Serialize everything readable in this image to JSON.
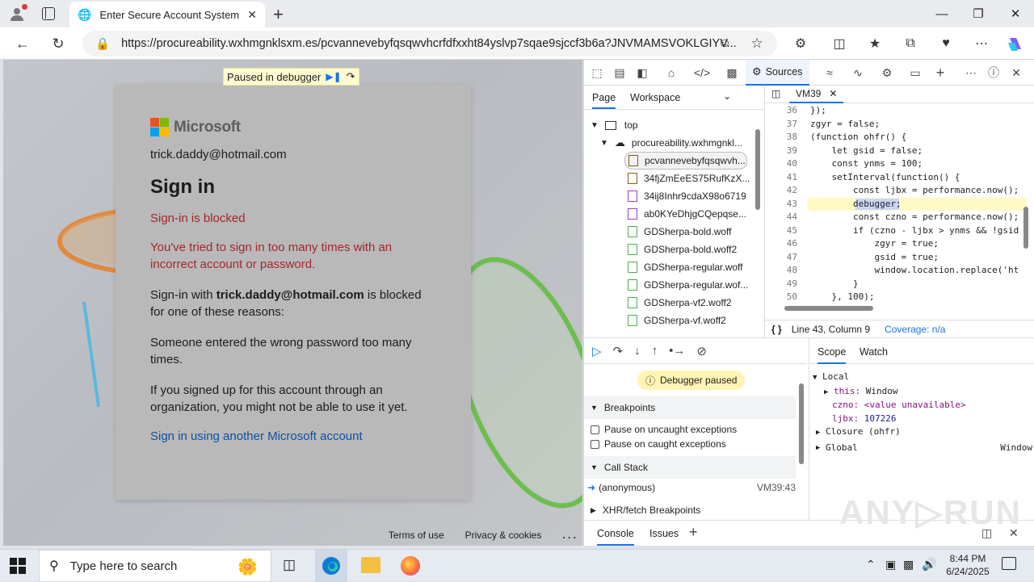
{
  "browser": {
    "tab_title": "Enter Secure Account System",
    "url": "https://procureability.wxhmgnklsxm.es/pcvannevebyfqsqwvhcrfdfxxht84yslvp7sqae9sjccf3b6a?JNVMAMSVOKLGIYV..."
  },
  "page": {
    "paused_label": "Paused in debugger",
    "brand": "Microsoft",
    "email": "trick.daddy@hotmail.com",
    "heading": "Sign in",
    "error_title": "Sign-in is blocked",
    "error_desc": "You've tried to sign in too many times with an incorrect account or password.",
    "reason_prefix": "Sign-in with ",
    "reason_email": "trick.daddy@hotmail.com",
    "reason_suffix": " is blocked for one of these reasons:",
    "reason1": "Someone entered the wrong password too many times.",
    "reason2": "If you signed up for this account through an organization, you might not be able to use it yet.",
    "link": "Sign in using another Microsoft account",
    "footer_terms": "Terms of use",
    "footer_privacy": "Privacy & cookies",
    "footer_more": ". . ."
  },
  "devtools": {
    "sources_tab": "Sources",
    "nav_tabs": [
      "Page",
      "Workspace"
    ],
    "file_tab": "VM39",
    "tree": {
      "top": "top",
      "domain": "procureability.wxhmgnkl...",
      "files": [
        "pcvannevebyfqsqwvh...",
        "34fjZmEeES75RufKzX...",
        "34ij8Inhr9cdaX98o6719",
        "ab0KYeDhjgCQepqse...",
        "GDSherpa-bold.woff",
        "GDSherpa-bold.woff2",
        "GDSherpa-regular.woff",
        "GDSherpa-regular.wof...",
        "GDSherpa-vf2.woff2",
        "GDSherpa-vf.woff2"
      ]
    },
    "code_lines": [
      {
        "n": "36",
        "t": "});"
      },
      {
        "n": "37",
        "t": "zgyr = false;"
      },
      {
        "n": "38",
        "t": "(function ohfr() {"
      },
      {
        "n": "39",
        "t": "    let gsid = false;"
      },
      {
        "n": "40",
        "t": "    const ynms = 100;"
      },
      {
        "n": "41",
        "t": "    setInterval(function() {"
      },
      {
        "n": "42",
        "t": "        const ljbx = performance.now();"
      },
      {
        "n": "43",
        "t": "        debugger;"
      },
      {
        "n": "44",
        "t": "        const czno = performance.now();"
      },
      {
        "n": "45",
        "t": "        if (czno - ljbx > ynms && !gsid"
      },
      {
        "n": "46",
        "t": "            zgyr = true;"
      },
      {
        "n": "47",
        "t": "            gsid = true;"
      },
      {
        "n": "48",
        "t": "            window.location.replace('ht"
      },
      {
        "n": "49",
        "t": "        }"
      },
      {
        "n": "50",
        "t": "    }, 100);"
      }
    ],
    "status_line": "Line 43, Column 9",
    "coverage": "Coverage: n/a",
    "debugger_paused": "Debugger paused",
    "breakpoints": "Breakpoints",
    "pause_uncaught": "Pause on uncaught exceptions",
    "pause_caught": "Pause on caught exceptions",
    "call_stack": "Call Stack",
    "stack_fn": "(anonymous)",
    "stack_loc": "VM39:43",
    "xhr_breakpoints": "XHR/fetch Breakpoints",
    "scope_tabs": [
      "Scope",
      "Watch"
    ],
    "scope": {
      "local": "Local",
      "this_key": "this:",
      "this_val": "Window",
      "czno_key": "czno:",
      "czno_val": "<value unavailable>",
      "ljbx_key": "ljbx:",
      "ljbx_val": "107226",
      "closure": "Closure (ohfr)",
      "global": "Global",
      "global_val": "Window"
    },
    "drawer_tabs": [
      "Console",
      "Issues"
    ]
  },
  "taskbar": {
    "search_placeholder": "Type here to search",
    "time": "8:44 PM",
    "date": "6/24/2025"
  },
  "colors": {
    "error_red": "#a4262c",
    "link_blue": "#0f4fa0",
    "devtools_blue": "#1a73e8"
  }
}
